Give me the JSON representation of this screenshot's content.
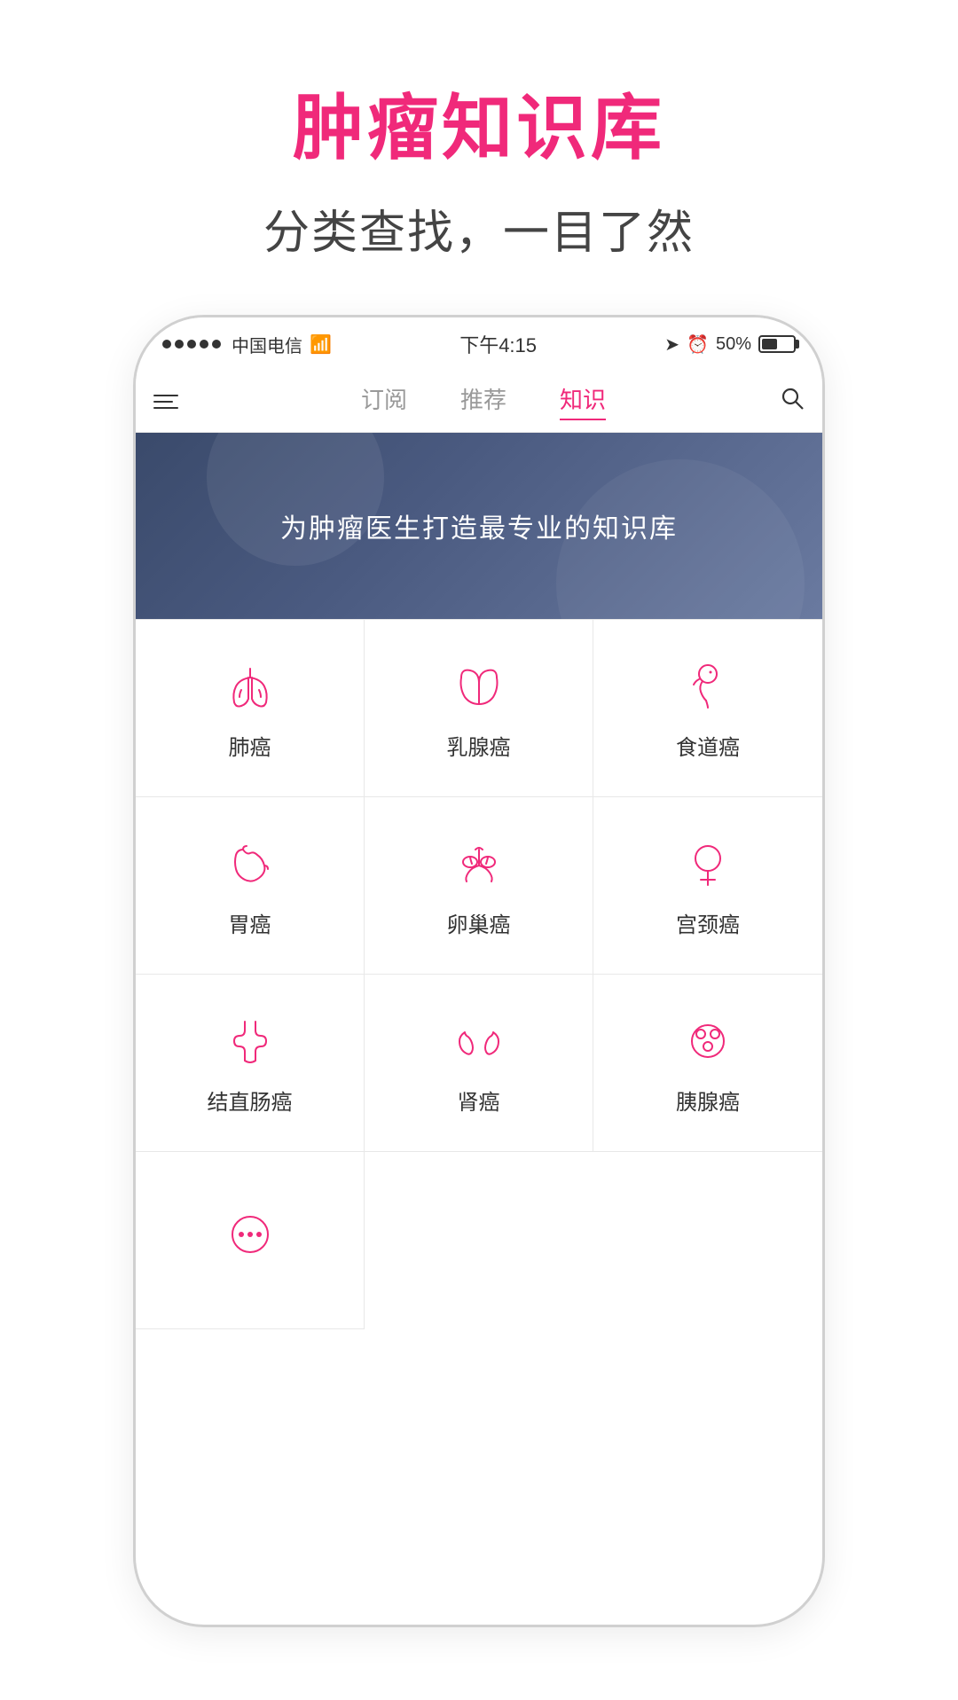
{
  "page": {
    "title": "肿瘤知识库",
    "subtitle": "分类查找，一目了然"
  },
  "statusBar": {
    "carrier": "中国电信",
    "wifi": "wifi",
    "time": "下午4:15",
    "battery": "50%"
  },
  "nav": {
    "tabs": [
      {
        "label": "订阅",
        "active": false
      },
      {
        "label": "推荐",
        "active": false
      },
      {
        "label": "知识",
        "active": true
      }
    ]
  },
  "banner": {
    "text": "为肿瘤医生打造最专业的知识库"
  },
  "cancerTypes": [
    {
      "id": "lung",
      "label": "肺癌",
      "icon": "lung"
    },
    {
      "id": "breast",
      "label": "乳腺癌",
      "icon": "breast"
    },
    {
      "id": "esophagus",
      "label": "食道癌",
      "icon": "esophagus"
    },
    {
      "id": "stomach",
      "label": "胃癌",
      "icon": "stomach"
    },
    {
      "id": "ovary",
      "label": "卵巢癌",
      "icon": "ovary"
    },
    {
      "id": "cervix",
      "label": "宫颈癌",
      "icon": "cervix"
    },
    {
      "id": "colorectal",
      "label": "结直肠癌",
      "icon": "colorectal"
    },
    {
      "id": "kidney",
      "label": "肾癌",
      "icon": "kidney"
    },
    {
      "id": "pancreas",
      "label": "胰腺癌",
      "icon": "pancreas"
    },
    {
      "id": "more",
      "label": "",
      "icon": "more"
    }
  ]
}
